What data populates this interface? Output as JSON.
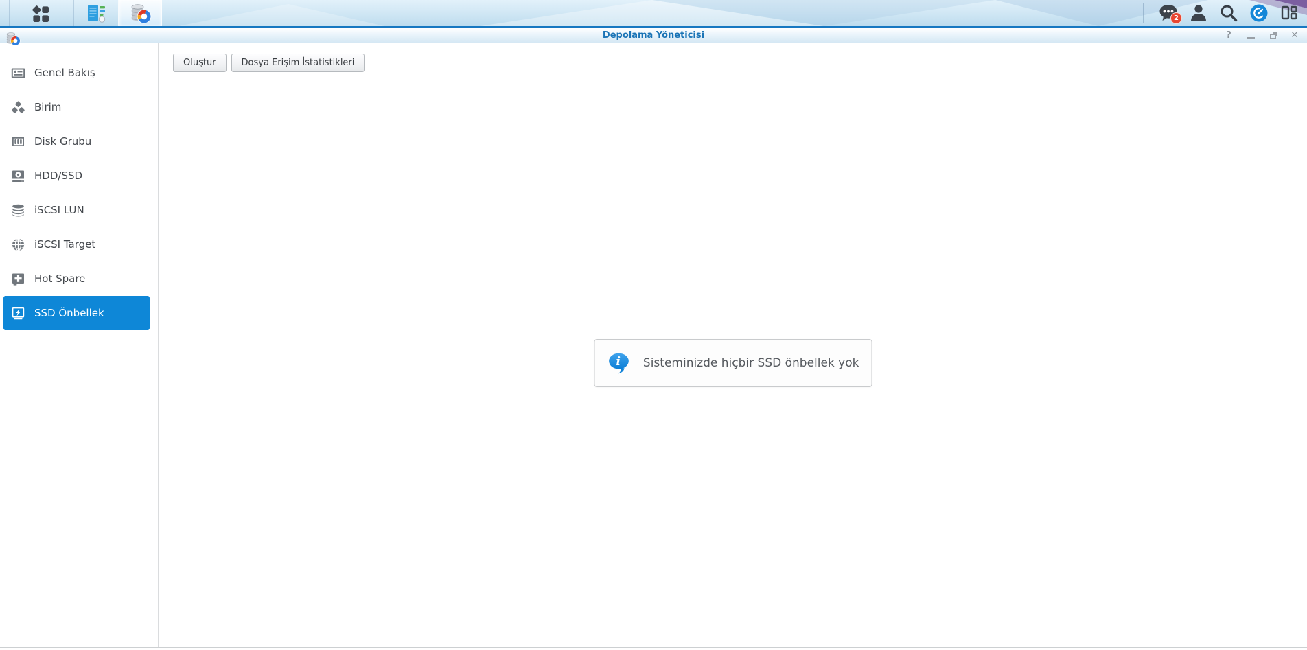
{
  "taskbar": {
    "notification_badge": "2",
    "icons": [
      "main-menu",
      "control-panel-app",
      "storage-manager-app",
      "notifications",
      "user",
      "search",
      "pilot-view",
      "widgets"
    ]
  },
  "window": {
    "title": "Depolama Yöneticisi",
    "controls": {
      "help": "?",
      "close": "✕"
    }
  },
  "sidebar": {
    "items": [
      {
        "label": "Genel Bakış",
        "icon": "overview-icon",
        "selected": false
      },
      {
        "label": "Birim",
        "icon": "volume-icon",
        "selected": false
      },
      {
        "label": "Disk Grubu",
        "icon": "disk-group-icon",
        "selected": false
      },
      {
        "label": "HDD/SSD",
        "icon": "hdd-ssd-icon",
        "selected": false
      },
      {
        "label": "iSCSI LUN",
        "icon": "iscsi-lun-icon",
        "selected": false
      },
      {
        "label": "iSCSI Target",
        "icon": "iscsi-target-icon",
        "selected": false
      },
      {
        "label": "Hot Spare",
        "icon": "hot-spare-icon",
        "selected": false
      },
      {
        "label": "SSD Önbellek",
        "icon": "ssd-cache-icon",
        "selected": true
      }
    ]
  },
  "toolbar": {
    "create_label": "Oluştur",
    "stats_label": "Dosya Erişim İstatistikleri"
  },
  "main": {
    "empty_message": "Sisteminizde hiçbir SSD önbellek yok"
  },
  "colors": {
    "accent_blue": "#0e87d7",
    "taskbar_line": "#1878c1",
    "title_text": "#1a74b6",
    "badge_red": "#e84732",
    "info_bubble_blue": "#1e90e2"
  }
}
